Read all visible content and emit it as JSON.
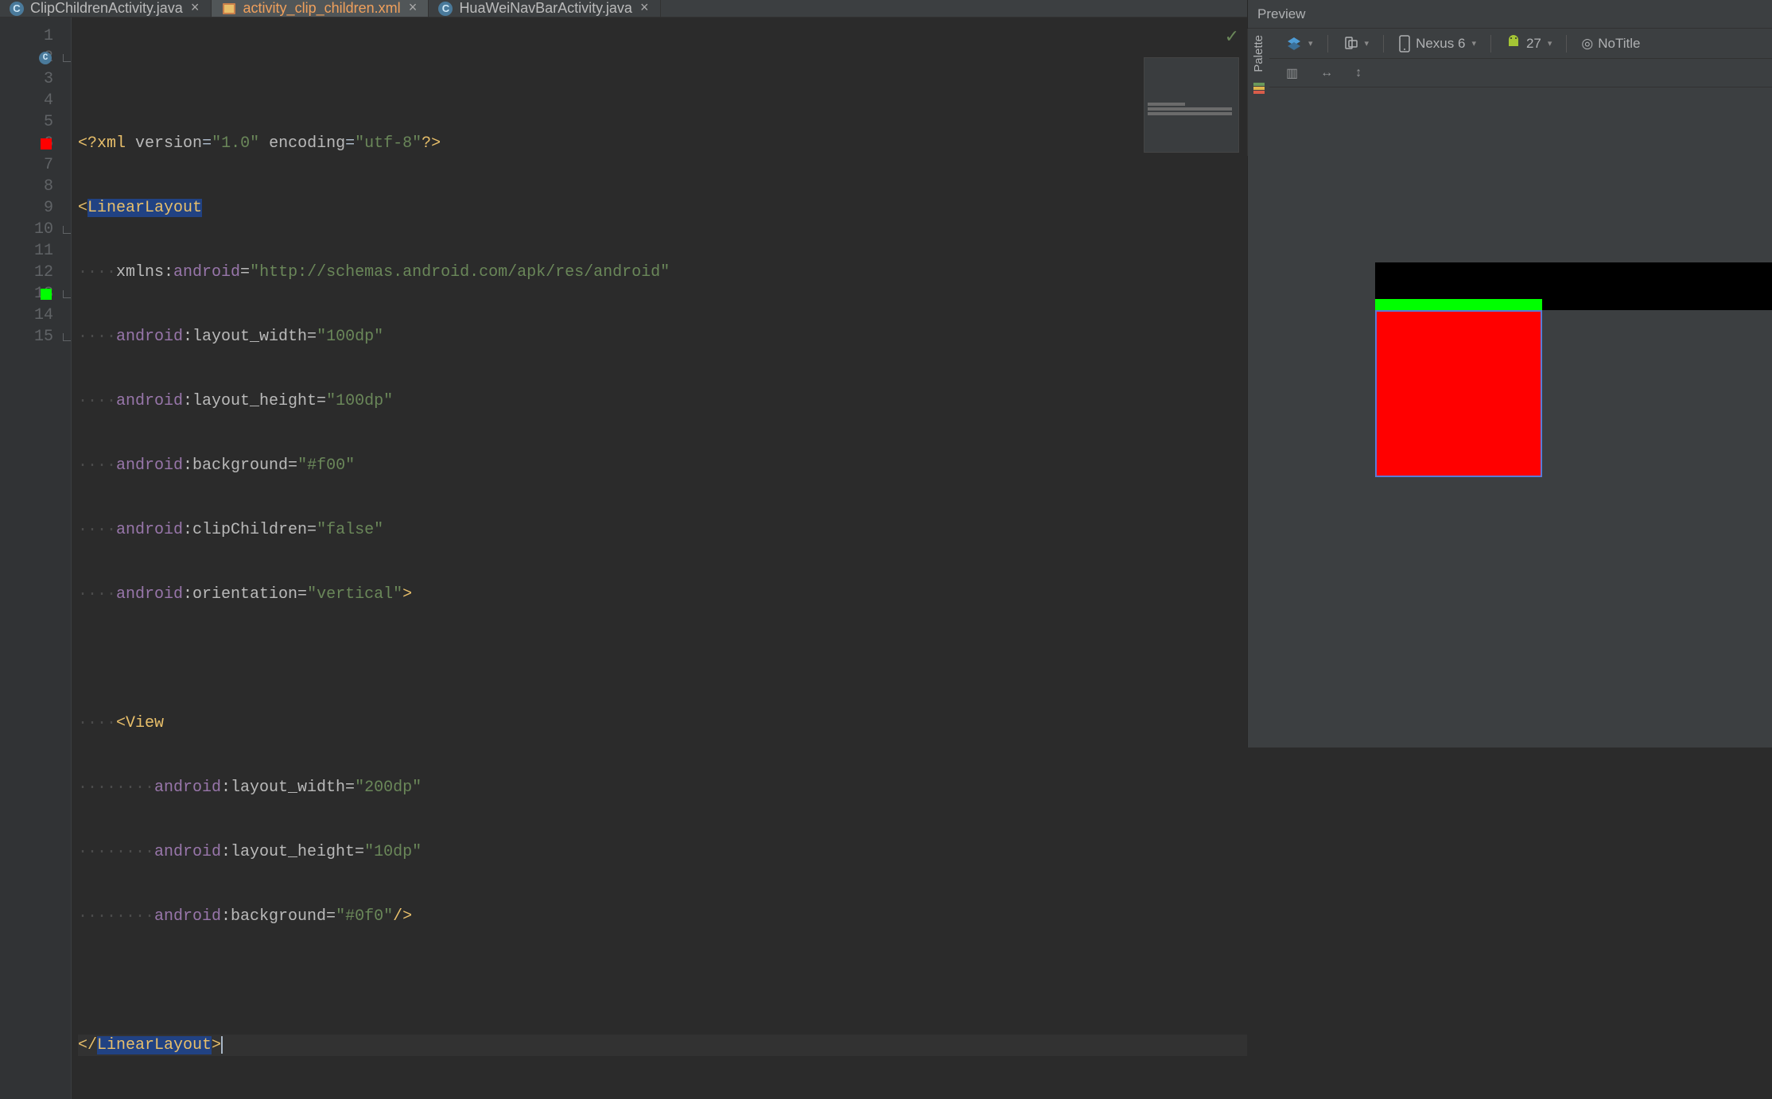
{
  "tabs": [
    {
      "label": "ClipChildrenActivity.java",
      "icon": "C"
    },
    {
      "label": "activity_clip_children.xml",
      "icon": "xml",
      "active": true
    },
    {
      "label": "HuaWeiNavBarActivity.java",
      "icon": "C"
    }
  ],
  "gutter": {
    "lines": [
      "1",
      "2",
      "3",
      "4",
      "5",
      "6",
      "7",
      "8",
      "9",
      "10",
      "11",
      "12",
      "13",
      "14",
      "15"
    ],
    "class_icon_line": 2,
    "red_chip_line": 6,
    "green_chip_line": 13,
    "fold_lines": [
      2,
      10,
      15
    ]
  },
  "code": {
    "l1": {
      "pre": "<?",
      "tag": "xml",
      "a1n": "version",
      "a1v": "\"1.0\"",
      "a2n": "encoding",
      "a2v": "\"utf-8\"",
      "post": "?>"
    },
    "l2": {
      "open": "<",
      "tag": "LinearLayout"
    },
    "l3": {
      "prefix": "xmlns:",
      "ns": "android",
      "eq": "=",
      "val": "\"http://schemas.android.com/apk/res/android\""
    },
    "l4": {
      "prefix": "android",
      "name": ":layout_width=",
      "val": "\"100dp\""
    },
    "l5": {
      "prefix": "android",
      "name": ":layout_height=",
      "val": "\"100dp\""
    },
    "l6": {
      "prefix": "android",
      "name": ":background=",
      "val": "\"#f00\""
    },
    "l7": {
      "prefix": "android",
      "name": ":clipChildren=",
      "val": "\"false\""
    },
    "l8": {
      "prefix": "android",
      "name": ":orientation=",
      "val": "\"vertical\"",
      "close": ">"
    },
    "l10": {
      "open": "<",
      "tag": "View"
    },
    "l11": {
      "prefix": "android",
      "name": ":layout_width=",
      "val": "\"200dp\""
    },
    "l12": {
      "prefix": "android",
      "name": ":layout_height=",
      "val": "\"10dp\""
    },
    "l13": {
      "prefix": "android",
      "name": ":background=",
      "val": "\"#0f0\"",
      "close": "/>"
    },
    "l15": {
      "open": "</",
      "tag": "LinearLayout",
      "close": ">"
    }
  },
  "preview": {
    "title": "Preview",
    "palette": "Palette",
    "device": "Nexus 6",
    "api": "27",
    "theme": "NoTitle"
  },
  "icons": {
    "close": "×",
    "caret": "▾",
    "tick": "✓",
    "layers": "◧",
    "rotate": "◇",
    "phone": "▭",
    "android": "⬢",
    "globe": "◎",
    "columns": "▥",
    "harrow": "↔",
    "varrow": "↕"
  }
}
